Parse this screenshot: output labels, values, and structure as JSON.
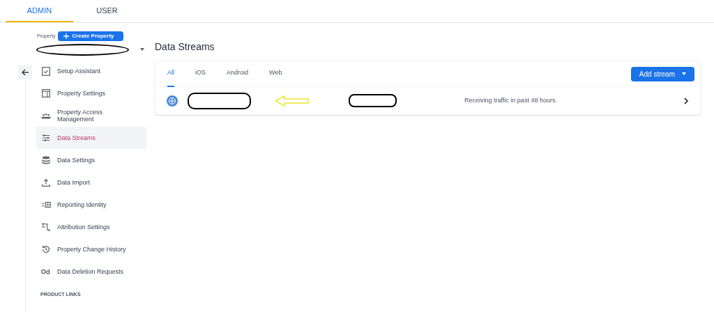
{
  "top_tabs": [
    {
      "label": "ADMIN",
      "selected": true
    },
    {
      "label": "USER",
      "selected": false
    }
  ],
  "property": {
    "label": "Property",
    "create_button": "Create Property"
  },
  "menu": [
    {
      "label": "Setup Assistant",
      "selected": false
    },
    {
      "label": "Property Settings",
      "selected": false
    },
    {
      "label": "Property Access Management",
      "selected": false
    },
    {
      "label": "Data Streams",
      "selected": true
    },
    {
      "label": "Data Settings",
      "selected": false
    },
    {
      "label": "Data Import",
      "selected": false
    },
    {
      "label": "Reporting Identity",
      "selected": false
    },
    {
      "label": "Attribution Settings",
      "selected": false
    },
    {
      "label": "Property Change History",
      "selected": false
    },
    {
      "label": "Data Deletion Requests",
      "selected": false
    }
  ],
  "product_links_heading": "PRODUCT LINKS",
  "page_title": "Data Streams",
  "stream_tabs": [
    {
      "label": "All",
      "selected": true
    },
    {
      "label": "iOS",
      "selected": false
    },
    {
      "label": "Android",
      "selected": false
    },
    {
      "label": "Web",
      "selected": false
    }
  ],
  "add_button": "Add stream",
  "streams": [
    {
      "status": "Receiving traffic in past 48 hours."
    }
  ]
}
